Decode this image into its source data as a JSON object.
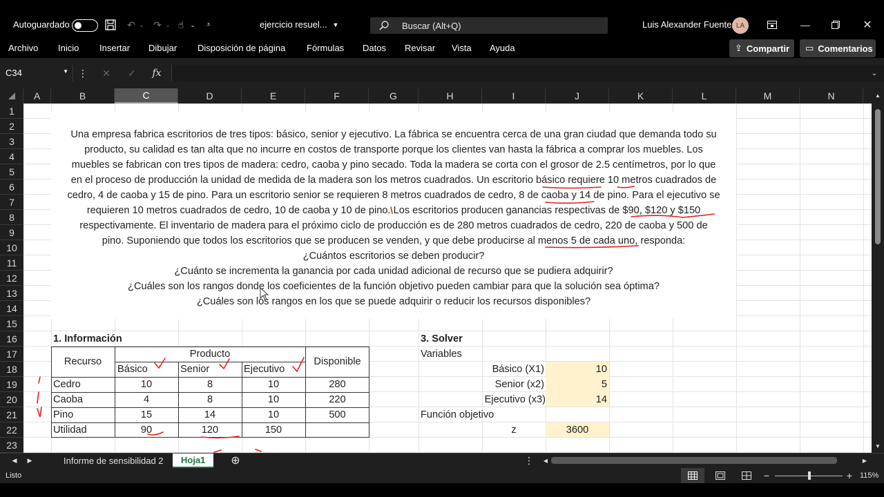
{
  "titlebar": {
    "autosave_label": "Autoguardado",
    "filename": "ejercicio resuel...",
    "search_placeholder": "Buscar (Alt+Q)",
    "user_name": "Luis Alexander Fuentes",
    "user_initials": "LA"
  },
  "menu": {
    "items": [
      "Archivo",
      "Inicio",
      "Insertar",
      "Dibujar",
      "Disposición de página",
      "Fórmulas",
      "Datos",
      "Revisar",
      "Vista",
      "Ayuda"
    ],
    "share_label": "Compartir",
    "comments_label": "Comentarios"
  },
  "formula_bar": {
    "name_box": "C34",
    "fx_label": "fx",
    "content": ""
  },
  "columns": [
    "A",
    "B",
    "C",
    "D",
    "E",
    "F",
    "G",
    "H",
    "I",
    "J",
    "K",
    "L",
    "M",
    "N"
  ],
  "selected_column": "C",
  "rows": [
    "1",
    "2",
    "3",
    "4",
    "5",
    "6",
    "7",
    "8",
    "9",
    "10",
    "11",
    "12",
    "13",
    "14",
    "15",
    "16",
    "17",
    "18",
    "19",
    "20",
    "21",
    "22",
    "23"
  ],
  "problem_text": [
    "Una empresa fabrica escritorios de tres tipos: básico, senior y ejecutivo. La fábrica se encuentra cerca de una gran ciudad que demanda todo su",
    "producto, su calidad es tan alta que no incurre en costos de transporte porque los clientes van hasta la fábrica a comprar los muebles. Los",
    "muebles se fabrican con tres tipos de madera: cedro, caoba y pino secado. Toda la madera se corta con el grosor de 2.5 centímetros, por lo que",
    "en el proceso de producción la unidad de medida de la madera son los metros cuadrados. Un escritorio básico requiere 10 metros cuadrados de",
    "cedro, 4 de caoba y 15 de pino. Para un escritorio senior se requieren 8 metros cuadrados de cedro, 8 de caoba y 14 de pino. Para el ejecutivo se",
    "requieren 10 metros cuadrados de cedro, 10 de caoba y 10 de pino. Los escritorios producen ganancias respectivas de $90, $120 y $150",
    "respectivamente. El inventario de madera para el próximo ciclo de producción es de 280 metros cuadrados de cedro, 220 de caoba y 500 de",
    "pino. Suponiendo que todos los escritorios que se producen se venden, y que debe producirse al menos 5 de cada uno, responda:",
    "¿Cuántos escritorios se deben producir?",
    "¿Cuánto se incrementa la ganancia por cada unidad adicional de recurso que se pudiera adquirir?",
    "¿Cuáles son los rangos donde los coeficientes de la función objetivo pueden cambiar para que la solución sea óptima?",
    "¿Cuáles son los rangos en los que se puede adquirir o reducir los recursos disponibles?"
  ],
  "info": {
    "title": "1. Información",
    "h_recurso": "Recurso",
    "h_producto": "Producto",
    "h_disponible": "Disponible",
    "products": [
      "Básico",
      "Senior",
      "Ejecutivo"
    ],
    "rows": [
      {
        "name": "Cedro",
        "values": [
          "10",
          "8",
          "10"
        ],
        "available": "280"
      },
      {
        "name": "Caoba",
        "values": [
          "4",
          "8",
          "10"
        ],
        "available": "220"
      },
      {
        "name": "Pino",
        "values": [
          "15",
          "14",
          "10"
        ],
        "available": "500"
      },
      {
        "name": "Utilidad",
        "values": [
          "90",
          "120",
          "150"
        ],
        "available": ""
      }
    ]
  },
  "solver": {
    "title": "3. Solver",
    "variables_label": "Variables",
    "vars": [
      {
        "label": "Básico (X1)",
        "value": "10"
      },
      {
        "label": "Senior (x2)",
        "value": "5"
      },
      {
        "label": "Ejecutivo (x3)",
        "value": "14"
      }
    ],
    "objective_label": "Función objetivo",
    "z_label": "z",
    "z_value": "3600"
  },
  "sheet_tabs": [
    "Informe de sensibilidad 2",
    "Hoja1"
  ],
  "active_tab": "Hoja1",
  "status": {
    "mode": "Listo",
    "zoom": "115%"
  },
  "colors": {
    "annotation_red": "#e0201a",
    "input_fill": "#fff2cc",
    "active_tab_green": "#1e7145"
  }
}
